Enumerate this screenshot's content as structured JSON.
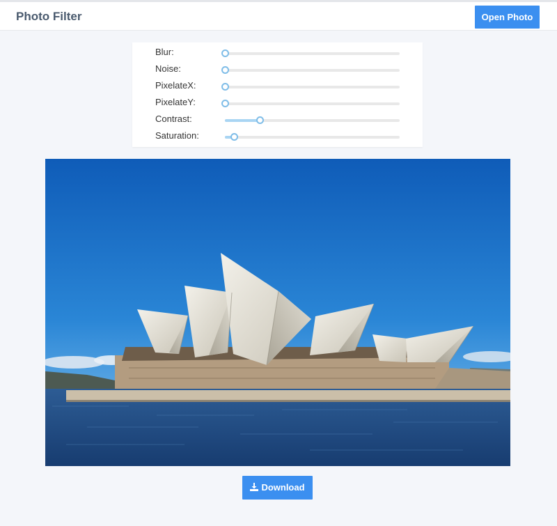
{
  "app": {
    "title": "Photo Filter"
  },
  "toolbar": {
    "open_label": "Open Photo"
  },
  "colors": {
    "accent": "#3b8ff0",
    "slider_fill": "#a9d5f3",
    "slider_thumb_border": "#7fbde8"
  },
  "filters": [
    {
      "label": "Blur:",
      "value_fraction": 0.0
    },
    {
      "label": "Noise:",
      "value_fraction": 0.0
    },
    {
      "label": "PixelateX:",
      "value_fraction": 0.0
    },
    {
      "label": "PixelateY:",
      "value_fraction": 0.0
    },
    {
      "label": "Contrast:",
      "value_fraction": 0.2
    },
    {
      "label": "Saturation:",
      "value_fraction": 0.05
    }
  ],
  "image": {
    "subject": "photo"
  },
  "footer": {
    "download_label": "Download",
    "download_icon": "download-icon"
  }
}
